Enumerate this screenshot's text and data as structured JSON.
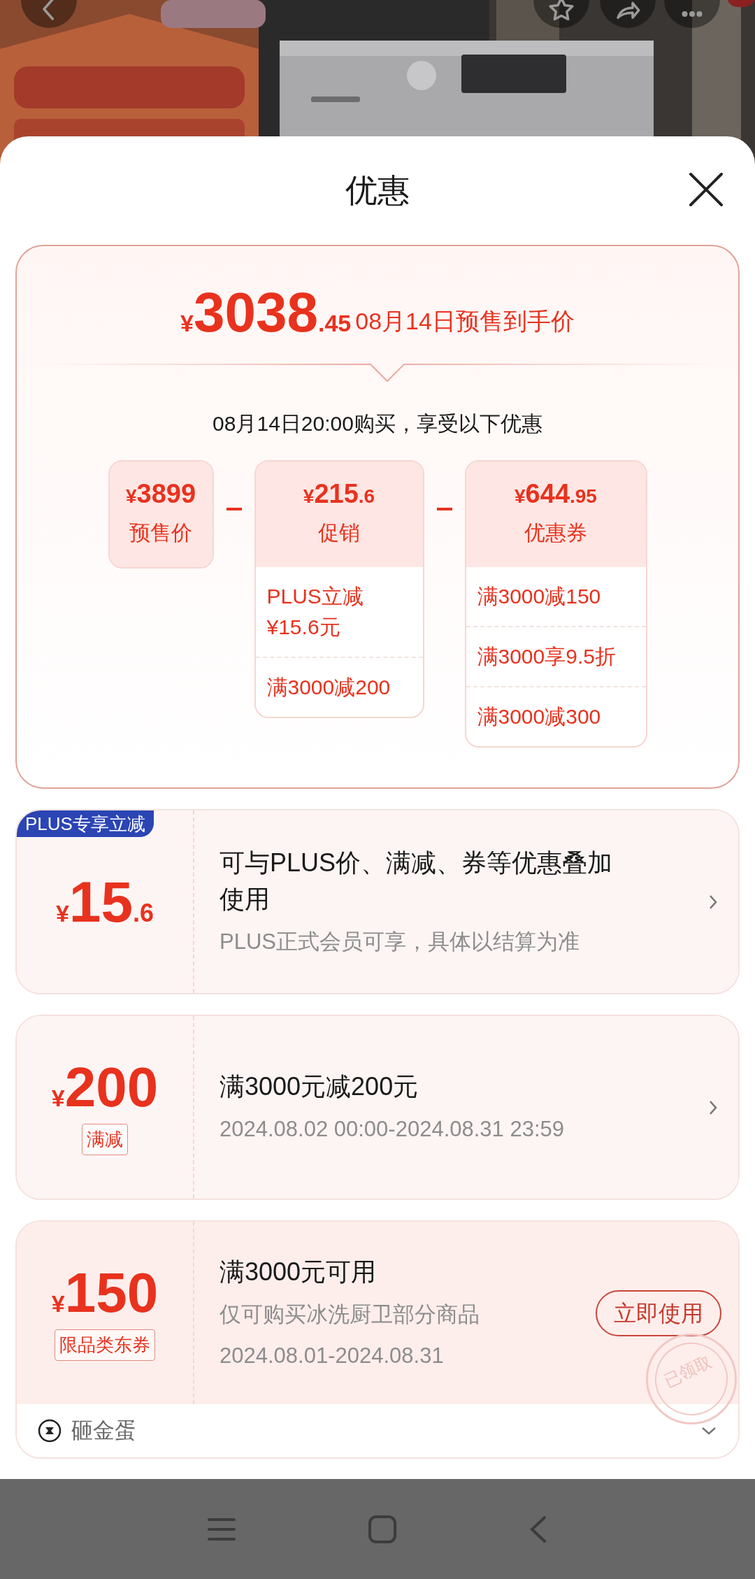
{
  "sheet": {
    "title": "优惠"
  },
  "summary": {
    "price": {
      "symbol": "¥",
      "integer": "3038",
      "decimal": ".45"
    },
    "price_label": "08月14日预售到手价",
    "subtitle": "08月14日20:00购买，享受以下优惠",
    "breakdown": [
      {
        "amount": {
          "symbol": "¥",
          "integer": "3899"
        },
        "label": "预售价"
      },
      {
        "amount": {
          "symbol": "¥",
          "integer": "215",
          "decimal": ".6"
        },
        "label": "促销",
        "details": [
          "PLUS立减\n¥15.6元",
          "满3000减200"
        ]
      },
      {
        "amount": {
          "symbol": "¥",
          "integer": "644",
          "decimal": ".95"
        },
        "label": "优惠券",
        "details": [
          "满3000减150",
          "满3000享9.5折",
          "满3000减300"
        ]
      }
    ]
  },
  "offers": [
    {
      "kind": "plus",
      "badge": "PLUS专享立减",
      "amount": {
        "symbol": "¥",
        "integer": "15",
        "decimal": ".6"
      },
      "title": "可与PLUS价、满减、券等优惠叠加使用",
      "lines": [
        "PLUS正式会员可享，具体以结算为准"
      ]
    },
    {
      "kind": "discount",
      "tag": "满减",
      "amount": {
        "symbol": "¥",
        "integer": "200"
      },
      "title": "满3000元减200元",
      "lines": [
        "2024.08.02 00:00-2024.08.31 23:59"
      ]
    },
    {
      "kind": "coupon",
      "tag": "限品类东券",
      "amount": {
        "symbol": "¥",
        "integer": "150"
      },
      "title": "满3000元可用",
      "lines": [
        "仅可购买冰洗厨卫部分商品",
        "2024.08.01-2024.08.31"
      ],
      "action": "立即使用",
      "stamp": "已领取",
      "footer": "砸金蛋"
    }
  ]
}
